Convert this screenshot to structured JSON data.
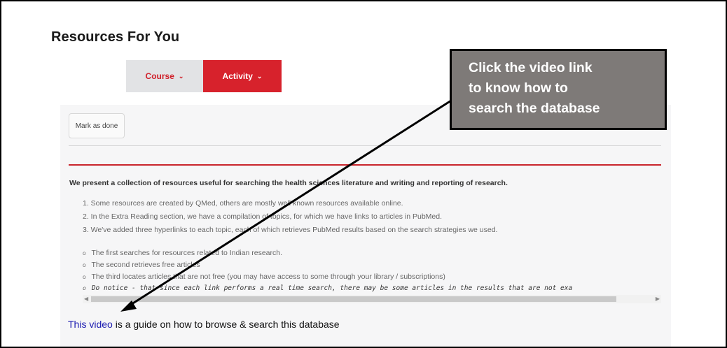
{
  "page_title": "Resources For You",
  "tabs": [
    {
      "label": "Course",
      "icon": "chevron-down-icon"
    },
    {
      "label": "Activity",
      "icon": "chevron-down-icon"
    }
  ],
  "mark_done_label": "Mark as done",
  "intro": "We present a collection of resources useful for searching the health sciences literature and writing and reporting of research.",
  "numbered_items": [
    "1. Some resources are created by QMed, others are mostly well known resources available online.",
    "2. In the Extra Reading section, we have a compilation of topics, for which we have links to articles in PubMed.",
    "3. We've added three hyperlinks to each topic, each of which retrieves PubMed results based on the search strategies we used."
  ],
  "bullet_marker": "o",
  "bullet_items": [
    "The first searches for resources related to Indian research.",
    "The second retrieves free articles",
    "The third locates articles that are not free (you may have access to some through your library / subscriptions)",
    "Do notice - that since each link performs a real time search, there may be some articles in the results that are not exa"
  ],
  "video_link_text": "This video",
  "video_line_rest": " is a guide on how to browse & search this database",
  "callout_text": "Click the video link\nto know how to\nsearch the database",
  "colors": {
    "accent_red": "#d7222c",
    "callout_bg": "#7e7a78",
    "link_blue": "#1a1ab0"
  }
}
